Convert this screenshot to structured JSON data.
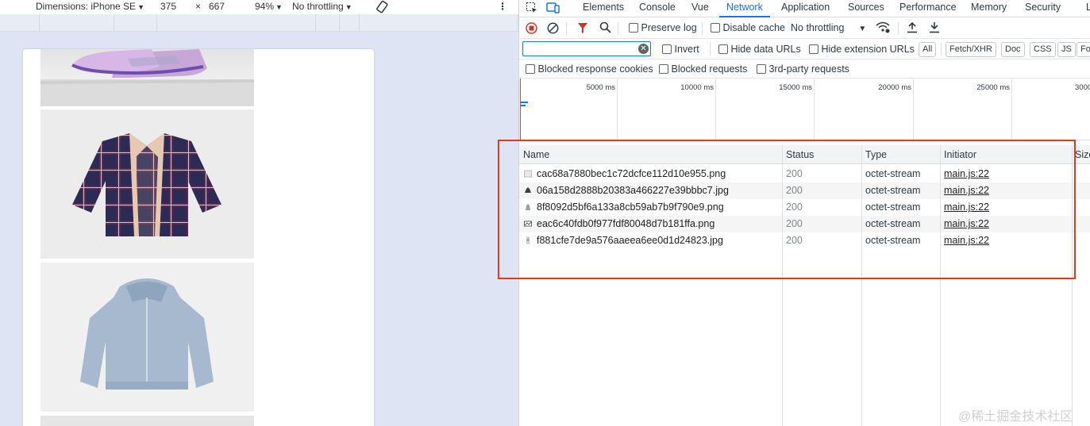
{
  "device_toolbar": {
    "dimensions": "Dimensions: iPhone SE",
    "width": "375",
    "times": "×",
    "height": "667",
    "zoom": "94%",
    "throttle": "No throttling",
    "more": "⋮"
  },
  "devtools": {
    "tabs": [
      "Elements",
      "Console",
      "Vue",
      "Network",
      "Application",
      "Sources",
      "Performance",
      "Memory",
      "Security",
      "L"
    ],
    "active_tab": "Network",
    "toolbar": {
      "preserve_log": "Preserve log",
      "disable_cache": "Disable cache",
      "throttle": "No throttling"
    },
    "filter": {
      "value": "",
      "invert": "Invert",
      "hide_data_urls": "Hide data URLs",
      "hide_extension_urls": "Hide extension URLs",
      "chips": [
        "All",
        "Fetch/XHR",
        "Doc",
        "CSS",
        "JS",
        "Fo"
      ]
    },
    "blocked": {
      "blocked_cookies": "Blocked response cookies",
      "blocked_requests": "Blocked requests",
      "third_party": "3rd-party requests"
    },
    "timeline_ticks": [
      "5000 ms",
      "10000 ms",
      "15000 ms",
      "20000 ms",
      "25000 ms",
      "3000"
    ],
    "table": {
      "headers": [
        "Name",
        "Status",
        "Type",
        "Initiator",
        "Size"
      ],
      "rows": [
        {
          "name": "cac68a7880bec1c72dcfce112d10e955.png",
          "status": "200",
          "type": "octet-stream",
          "initiator": "main.js:22"
        },
        {
          "name": "06a158d2888b20383a466227e39bbbc7.jpg",
          "status": "200",
          "type": "octet-stream",
          "initiator": "main.js:22"
        },
        {
          "name": "8f8092d5bf6a133a8cb59ab7b9f790e9.png",
          "status": "200",
          "type": "octet-stream",
          "initiator": "main.js:22"
        },
        {
          "name": "eac6c40fdb0f977fdf80048d7b181ffa.png",
          "status": "200",
          "type": "octet-stream",
          "initiator": "main.js:22"
        },
        {
          "name": "f881cfe7de9a576aaeea6ee0d1d24823.jpg",
          "status": "200",
          "type": "octet-stream",
          "initiator": "main.js:22"
        }
      ]
    }
  },
  "watermark": "@稀土掘金技术社区",
  "colors": {
    "accent": "#1a73e8",
    "record": "#d93025",
    "highlight": "#e03a1e"
  }
}
